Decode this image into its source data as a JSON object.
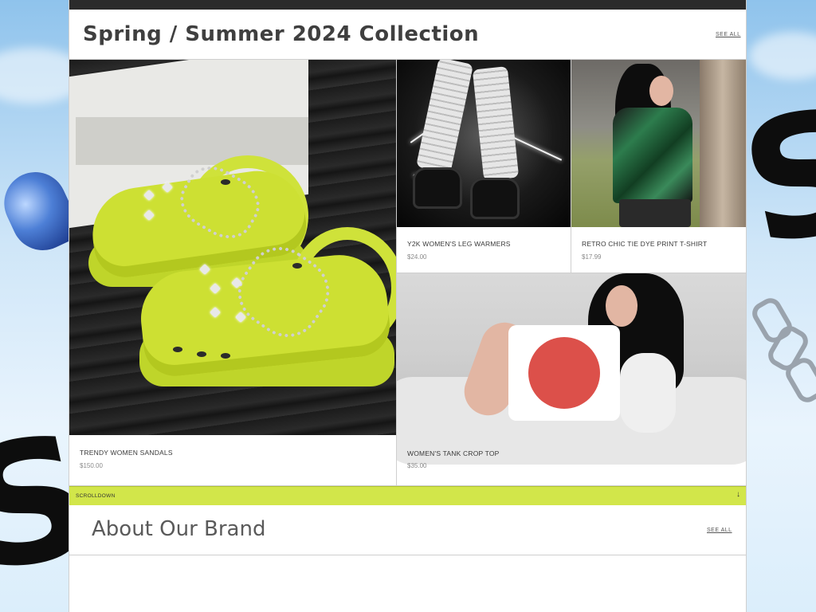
{
  "header": {
    "collection_title": "Spring / Summer 2024 Collection",
    "see_all_label": "SEE ALL"
  },
  "products": [
    {
      "name": "TRENDY WOMEN SANDALS",
      "price": "$150.00",
      "image_icon": "yellow-clog-sandals-image"
    },
    {
      "name": "Y2K WOMEN'S LEG WARMERS",
      "price": "$24.00",
      "image_icon": "leg-warmers-image"
    },
    {
      "name": "RETRO CHIC TIE DYE PRINT T-SHIRT",
      "price": "$17.99",
      "image_icon": "tie-dye-tshirt-image"
    },
    {
      "name": "WOMEN'S TANK CROP TOP",
      "price": "$35.00",
      "image_icon": "tank-crop-top-image"
    }
  ],
  "scroll_bar": {
    "label": "SCROLLDOWN",
    "icon": "↓"
  },
  "about": {
    "title": "About Our Brand",
    "see_all_label": "SEE ALL"
  },
  "colors": {
    "accent": "#d2e64a",
    "panel_bg": "#ffffff",
    "border": "#cfcfcf",
    "title_text": "#3f3f3f"
  }
}
